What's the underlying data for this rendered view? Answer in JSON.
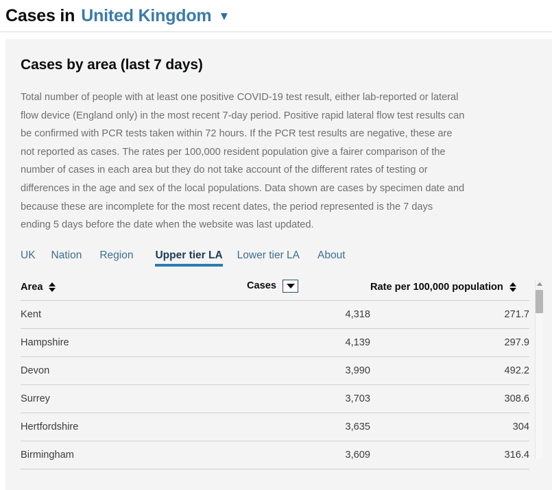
{
  "header": {
    "title_static": "Cases in",
    "location": "United Kingdom",
    "caret": "▼"
  },
  "main": {
    "heading": "Cases by area (last 7 days)",
    "description": "Total number of people with at least one positive COVID-19 test result, either lab-reported or lateral flow device (England only) in the most recent 7-day period. Positive rapid lateral flow test results can be confirmed with PCR tests taken within 72 hours. If the PCR test results are negative, these are not reported as cases. The rates per 100,000 resident population give a fairer comparison of the number of cases in each area but they do not take account of the different rates of testing or differences in the age and sex of the local populations. Data shown are cases by specimen date and because these are incomplete for the most recent dates, the period represented is the 7 days ending 5 days before the date when the website was last updated.",
    "tabs": [
      {
        "label": "UK",
        "active": false
      },
      {
        "label": "Nation",
        "active": false
      },
      {
        "label": "Region",
        "active": false
      },
      {
        "label": "Upper tier LA",
        "active": true
      },
      {
        "label": "Lower tier LA",
        "active": false
      },
      {
        "label": "About",
        "active": false
      }
    ],
    "table": {
      "columns": [
        {
          "label": "Area",
          "sort_state": "none",
          "sort_icon": "sort-updown-icon"
        },
        {
          "label": "Cases",
          "sort_state": "descending",
          "sort_icon": "sort-descending-icon"
        },
        {
          "label": "Rate per 100,000 population",
          "sort_state": "none",
          "sort_icon": "sort-updown-icon"
        }
      ],
      "rows": [
        {
          "area": "Kent",
          "cases": "4,318",
          "rate": "271.7"
        },
        {
          "area": "Hampshire",
          "cases": "4,139",
          "rate": "297.9"
        },
        {
          "area": "Devon",
          "cases": "3,990",
          "rate": "492.2"
        },
        {
          "area": "Surrey",
          "cases": "3,703",
          "rate": "308.6"
        },
        {
          "area": "Hertfordshire",
          "cases": "3,635",
          "rate": "304"
        },
        {
          "area": "Birmingham",
          "cases": "3,609",
          "rate": "316.4"
        }
      ]
    },
    "scrollbar": {
      "up_arrow": "scroll-up-icon"
    }
  },
  "colors": {
    "link_blue": "#3a7ca8",
    "tab_blue": "#3d6e8f",
    "active_tab_underline": "#2b7cb0",
    "card_background": "#f4f4f4",
    "text_dark": "#0b0c0c",
    "text_muted": "#6f6f6f"
  }
}
